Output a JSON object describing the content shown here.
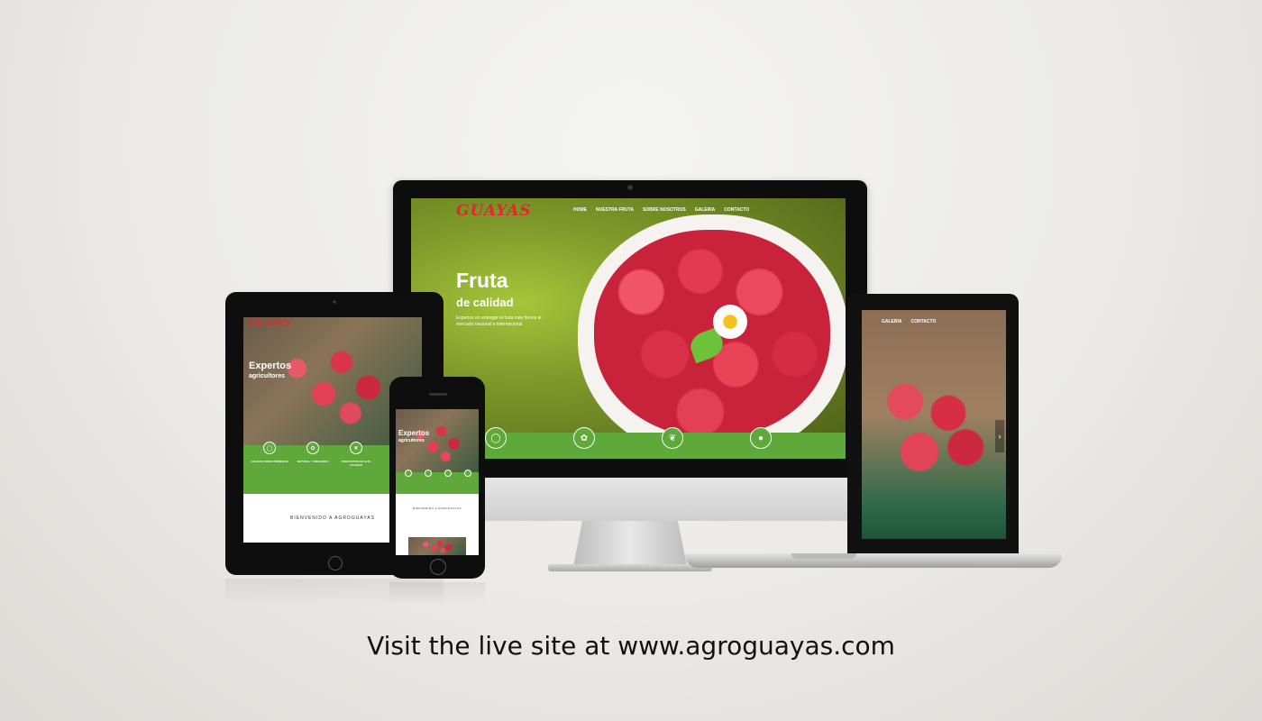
{
  "caption": "Visit the live site at www.agroguayas.com",
  "brand": {
    "logo_text": "GUAYAS",
    "logo_color": "#e0282e",
    "accent_green": "#5ea93a"
  },
  "imac": {
    "nav": [
      "HOME",
      "NUESTRA FRUTA",
      "SOBRE NOSOTROS",
      "GALERIA",
      "CONTACTO"
    ],
    "hero_title": "Fruta",
    "hero_subtitle": "de calidad",
    "hero_text": "Expertos en entregar la fruta mas fresca al mercado nacional e internacional",
    "feature_icons": [
      "apple-icon",
      "leaf-icon",
      "sprout-icon",
      "fruit-icon"
    ]
  },
  "laptop": {
    "nav": [
      "GALERIA",
      "CONTACTO"
    ]
  },
  "tablet": {
    "hero_title": "Expertos",
    "hero_subtitle": "agricultores",
    "features": [
      {
        "icon": "apple-icon",
        "title": "CALIDAD COMO PRIORIDAD"
      },
      {
        "icon": "leaf-icon",
        "title": "NATURAL Y ORGANICO"
      },
      {
        "icon": "sprout-icon",
        "title": "PRODUCTOS DE ALTA CALIDAD"
      }
    ],
    "welcome": "BIENVENIDO A AGROGUAYAS"
  },
  "phone": {
    "hero_title": "Expertos",
    "hero_subtitle": "agricultores",
    "welcome": "BIENVENIDO A AGROGUAYAS"
  }
}
